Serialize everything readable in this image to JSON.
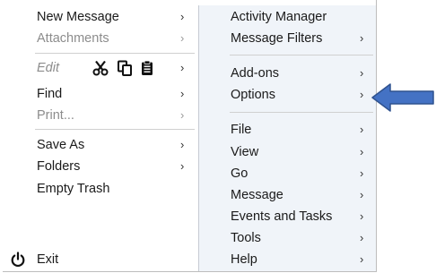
{
  "menu": {
    "left": {
      "new_message": "New Message",
      "attachments": "Attachments",
      "edit": "Edit",
      "find": "Find",
      "print": "Print...",
      "save_as": "Save As",
      "folders": "Folders",
      "empty_trash": "Empty Trash",
      "exit": "Exit"
    },
    "right": {
      "activity_manager": "Activity Manager",
      "message_filters": "Message Filters",
      "add_ons": "Add-ons",
      "options": "Options",
      "file": "File",
      "view": "View",
      "go": "Go",
      "message": "Message",
      "events_and_tasks": "Events and Tasks",
      "tools": "Tools",
      "help": "Help"
    },
    "submenu_glyph": "›",
    "edit_tools": [
      "cut-icon",
      "copy-icon",
      "paste-icon"
    ]
  },
  "colors": {
    "annotation_arrow": "#4472c4",
    "submenu_pane_bg": "#f0f4f9",
    "disabled_text": "#8c8c8c"
  }
}
